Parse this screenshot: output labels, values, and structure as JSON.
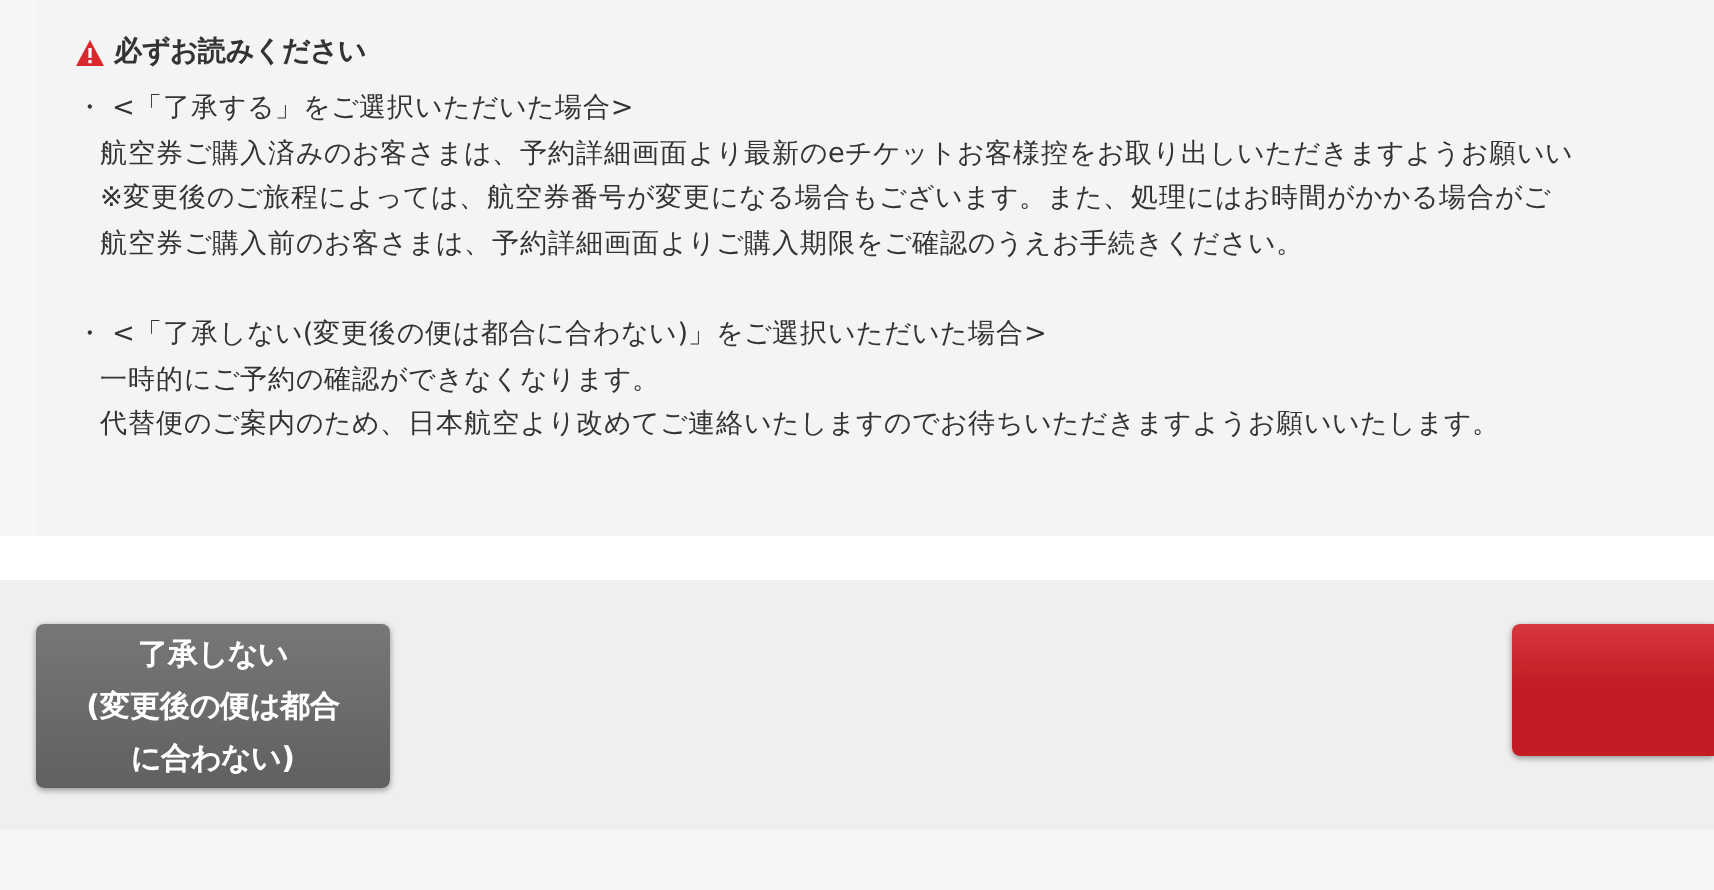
{
  "notice": {
    "title": "必ずお読みください",
    "sections": [
      {
        "bullet": "・",
        "heading": "<「了承する」をご選択いただいた場合>",
        "lines": [
          "航空券ご購入済みのお客さまは、予約詳細画面より最新のeチケットお客様控をお取り出しいただきますようお願いい",
          "※変更後のご旅程によっては、航空券番号が変更になる場合もございます。また、処理にはお時間がかかる場合がご",
          "航空券ご購入前のお客さまは、予約詳細画面よりご購入期限をご確認のうえお手続きください。"
        ]
      },
      {
        "bullet": "・",
        "heading": "<「了承しない(変更後の便は都合に合わない)」をご選択いただいた場合>",
        "lines": [
          "一時的にご予約の確認ができなくなります。",
          "代替便のご案内のため、日本航空より改めてご連絡いたしますのでお待ちいただきますようお願いいたします。"
        ]
      }
    ]
  },
  "buttons": [
    {
      "kind": "decline",
      "label_lines": [
        "了承しない",
        "(変更後の便は都合",
        "に合わない)"
      ]
    },
    {
      "kind": "accept"
    }
  ]
}
